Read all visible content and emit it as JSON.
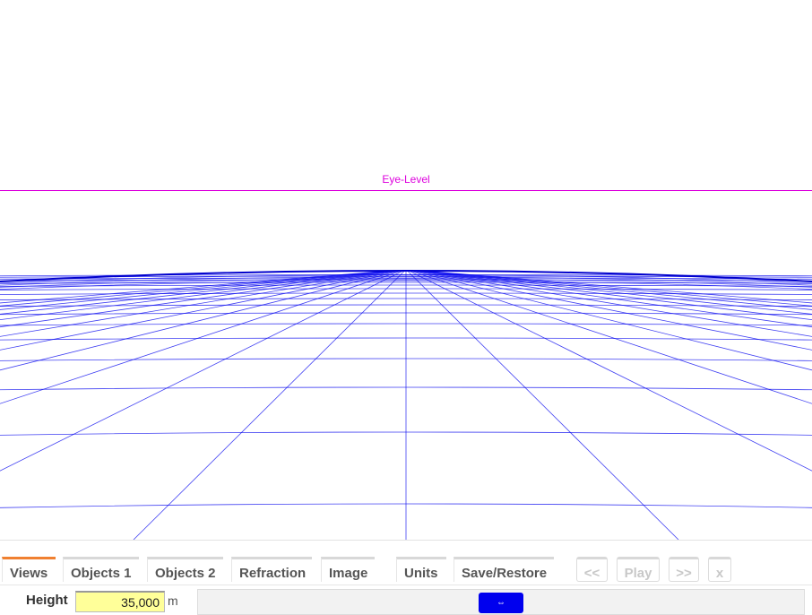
{
  "viewport": {
    "eye_level_label": "Eye-Level",
    "colors": {
      "eye_level": "#dd00dd",
      "grid": "#0000ee",
      "horizon": "#0000cc"
    }
  },
  "tabs": [
    {
      "label": "Views",
      "active": true
    },
    {
      "label": "Objects 1",
      "active": false
    },
    {
      "label": "Objects 2",
      "active": false
    },
    {
      "label": "Refraction",
      "active": false
    },
    {
      "label": "Image",
      "active": false
    },
    {
      "label": "Units",
      "active": false
    },
    {
      "label": "Save/Restore",
      "active": false
    }
  ],
  "nav": {
    "prev": "<<",
    "play": "Play",
    "next": ">>",
    "close": "x"
  },
  "height": {
    "label": "Height",
    "value": "35,000",
    "unit": "m"
  },
  "slider": {
    "handle_glyph": "⇔",
    "position": 0.5
  },
  "colors": {
    "active_tab": "#f08030",
    "input_bg": "#ffff99",
    "slider_handle": "#0000ee"
  }
}
